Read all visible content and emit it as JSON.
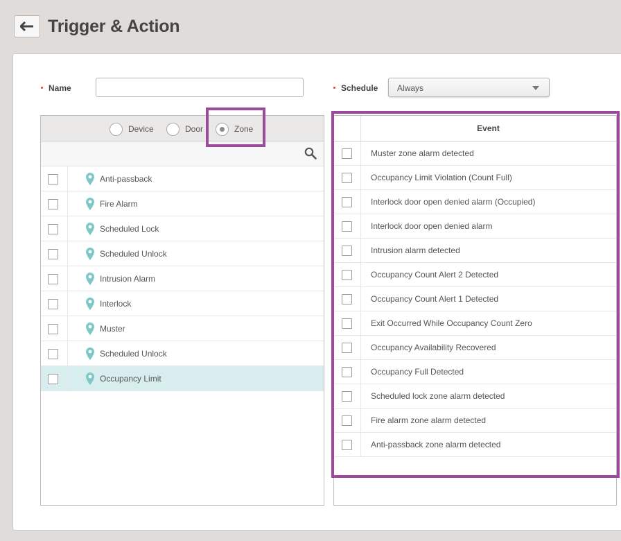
{
  "header": {
    "title": "Trigger & Action",
    "back_icon": "arrow-left-icon"
  },
  "form": {
    "name_label": "Name",
    "name_value": "",
    "schedule_label": "Schedule",
    "schedule_value": "Always",
    "required_color": "#e53935"
  },
  "filter": {
    "options": [
      {
        "label": "Device",
        "checked": false
      },
      {
        "label": "Door",
        "checked": false
      },
      {
        "label": "Zone",
        "checked": true
      }
    ],
    "search_icon": "search-icon"
  },
  "zones": [
    {
      "label": "Anti-passback",
      "selected": false
    },
    {
      "label": "Fire Alarm",
      "selected": false
    },
    {
      "label": "Scheduled Lock",
      "selected": false
    },
    {
      "label": "Scheduled Unlock",
      "selected": false
    },
    {
      "label": "Intrusion Alarm",
      "selected": false
    },
    {
      "label": "Interlock",
      "selected": false
    },
    {
      "label": "Muster",
      "selected": false
    },
    {
      "label": "Scheduled Unlock",
      "selected": false
    },
    {
      "label": "Occupancy Limit",
      "selected": true
    }
  ],
  "events": {
    "header": "Event",
    "items": [
      "Muster zone alarm detected",
      "Occupancy Limit Violation (Count Full)",
      "Interlock door open denied alarm (Occupied)",
      "Interlock door open denied alarm",
      "Intrusion alarm detected",
      "Occupancy Count Alert 2 Detected",
      "Occupancy Count Alert 1 Detected",
      "Exit Occurred While Occupancy Count Zero",
      "Occupancy Availability Recovered",
      "Occupancy Full Detected",
      "Scheduled lock zone alarm detected",
      "Fire alarm zone alarm detected",
      "Anti-passback zone alarm detected"
    ]
  },
  "colors": {
    "highlight": "#9c4a9c",
    "pin": "#7ec8c8",
    "selected_row": "#d8eeee"
  }
}
